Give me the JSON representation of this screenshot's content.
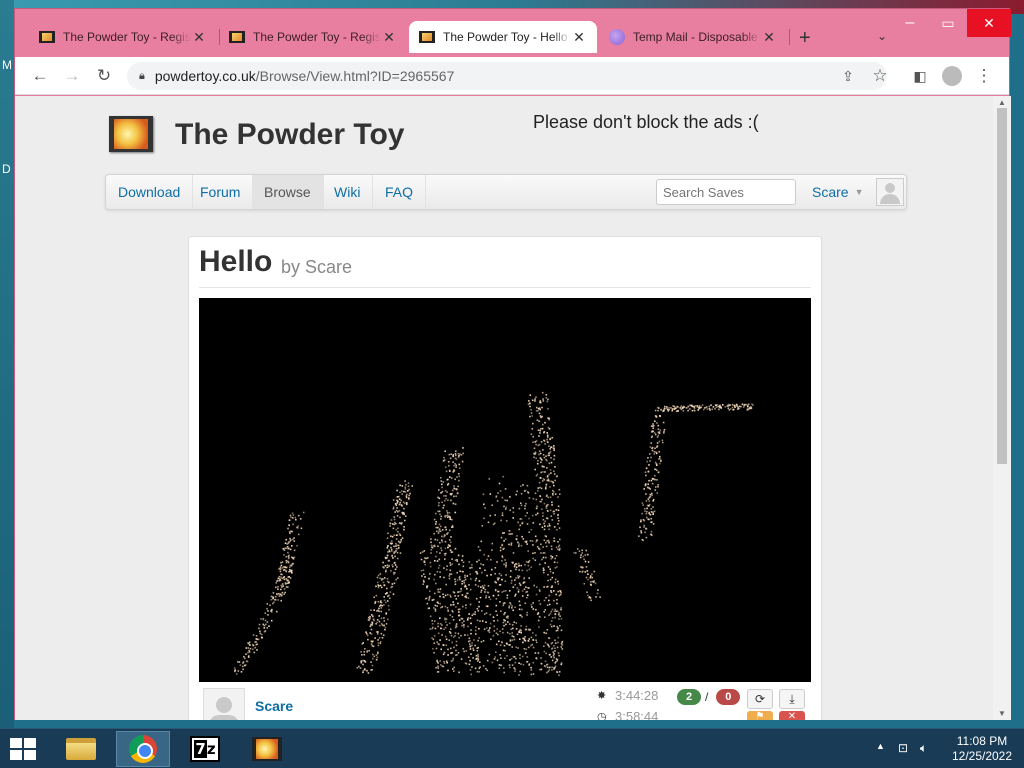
{
  "desktop": {
    "left_letters": [
      "M",
      "D"
    ]
  },
  "browser": {
    "tabs": [
      {
        "title": "The Powder Toy - Regis",
        "icon": "powder-toy-icon"
      },
      {
        "title": "The Powder Toy - Regis",
        "icon": "powder-toy-icon"
      },
      {
        "title": "The Powder Toy - Hello",
        "icon": "powder-toy-icon",
        "active": true
      },
      {
        "title": "Temp Mail - Disposable",
        "icon": "temp-mail-icon"
      }
    ],
    "url_host": "powdertoy.co.uk",
    "url_path": "/Browse/View.html?ID=2965567"
  },
  "site": {
    "title": "The Powder Toy",
    "ads_note": "Please don't block the ads :(",
    "nav": [
      "Download",
      "Forum",
      "Browse",
      "Wiki",
      "FAQ"
    ],
    "active_nav": "Browse",
    "search_placeholder": "Search Saves",
    "user": "Scare"
  },
  "save": {
    "title": "Hello",
    "by": "by Scare",
    "author": "Scare",
    "created": "3:44:28",
    "updated": "3:58:44",
    "votes_up": "2",
    "votes_sep": "/",
    "votes_down": "0"
  },
  "taskbar": {
    "apps": [
      "file-explorer",
      "chrome",
      "7-zip",
      "powder-toy"
    ],
    "time": "11:08 PM",
    "date": "12/25/2022"
  },
  "colors": {
    "window_frame": "#e8789c",
    "link": "#0e6ea6",
    "vote_up": "#468847",
    "vote_down": "#b94a48",
    "particles": "#f2d8b8"
  }
}
